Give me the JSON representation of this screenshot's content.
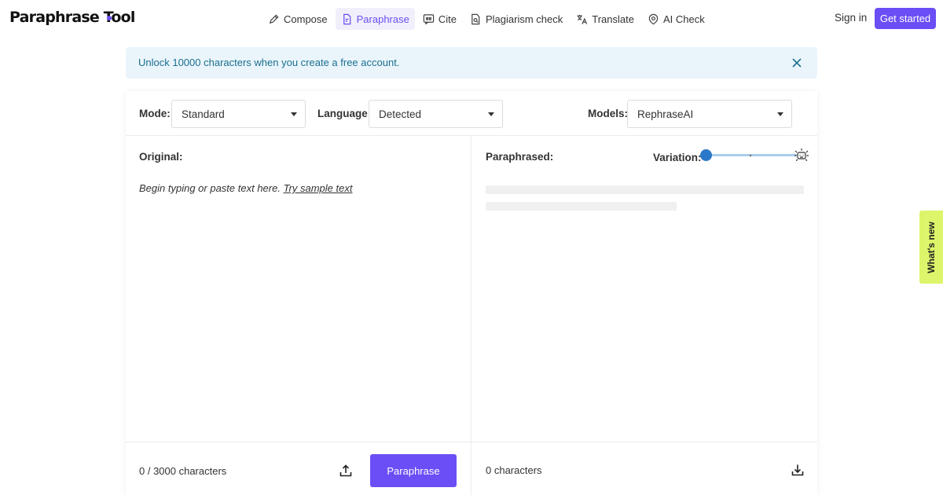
{
  "app": {
    "logo_text": "Paraphrase Tool",
    "brand_color": "#6b4ef5"
  },
  "nav": {
    "items": [
      {
        "label": "Compose",
        "icon": "pencil-icon",
        "active": false
      },
      {
        "label": "Paraphrase",
        "icon": "document-edit-icon",
        "active": true
      },
      {
        "label": "Cite",
        "icon": "quote-bubble-icon",
        "active": false
      },
      {
        "label": "Plagiarism check",
        "icon": "document-search-icon",
        "active": false
      },
      {
        "label": "Translate",
        "icon": "translate-icon",
        "active": false
      },
      {
        "label": "AI Check",
        "icon": "ai-shield-icon",
        "active": false
      }
    ],
    "sign_in": "Sign in",
    "get_started": "Get started"
  },
  "banner": {
    "text": "Unlock 10000 characters when you create a free account.",
    "color": "#eaf5fb"
  },
  "controls": {
    "mode_label": "Mode:",
    "mode_value": "Standard",
    "language_label": "Language:",
    "language_value": "Detected",
    "models_label": "Models:",
    "models_value": "RephraseAI"
  },
  "original": {
    "title": "Original:",
    "placeholder": "Begin typing or paste text here.",
    "sample_link": "Try sample text",
    "char_count": "0 / 3000 characters",
    "paraphrase_button": "Paraphrase"
  },
  "paraphrased": {
    "title": "Paraphrased:",
    "variation_label": "Variation:",
    "variation_level": 0,
    "char_count": "0 characters"
  },
  "whats_new": "What's new"
}
